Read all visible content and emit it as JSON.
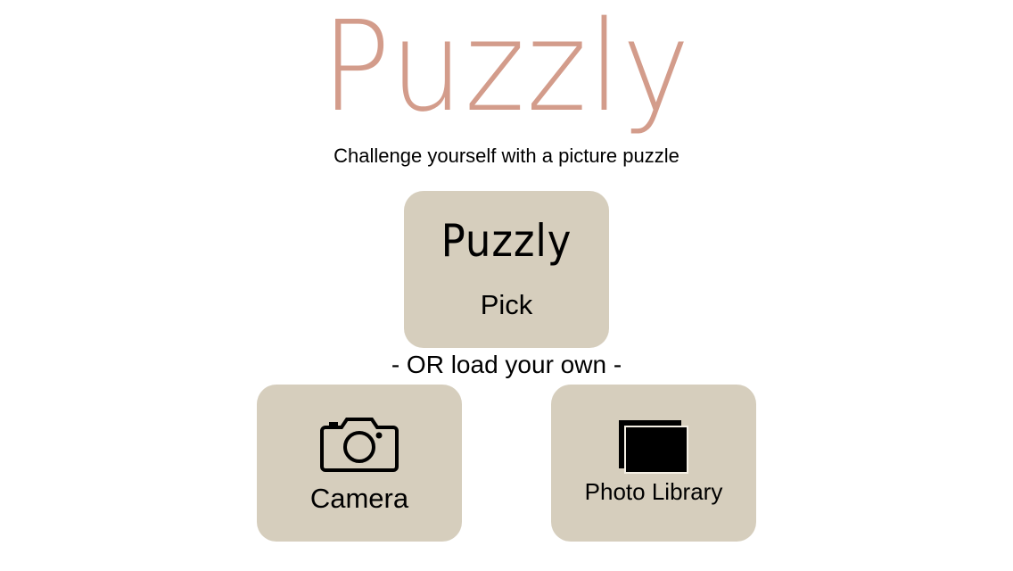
{
  "app": {
    "title": "Puzzly",
    "tagline": "Challenge yourself with a picture puzzle",
    "divider": "- OR load your own -"
  },
  "pick": {
    "logo": "Puzzly",
    "label": "Pick"
  },
  "camera": {
    "label": "Camera",
    "icon": "camera-icon"
  },
  "library": {
    "label": "Photo Library",
    "icon": "photo-library-icon"
  },
  "colors": {
    "title": "#d39c8b",
    "tile": "#d6cebd",
    "text": "#000000",
    "background": "#ffffff"
  }
}
